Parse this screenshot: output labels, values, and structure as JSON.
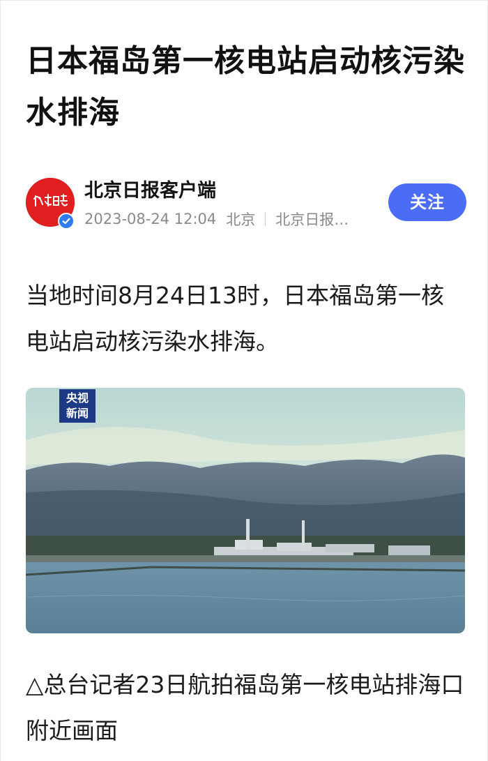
{
  "article": {
    "headline": "日本福岛第一核电站启动核污染水排海",
    "body": "当地时间8月24日13时，日本福岛第一核电站启动核污染水排海。",
    "caption": "△总台记者23日航拍福岛第一核电站排海口附近画面"
  },
  "author": {
    "name": "北京日报客户端",
    "avatar_logo_text": "北京日报",
    "date": "2023-08-24 12:04",
    "location": "北京",
    "source": "北京日报…",
    "follow_label": "关注",
    "verified_icon": "check-badge-icon"
  },
  "photo": {
    "watermark_line1": "央视",
    "watermark_line2": "新闻"
  },
  "colors": {
    "follow_button": "#4a6cf7",
    "avatar_bg": "#e02020",
    "verified_badge": "#2f7bf1",
    "watermark_bg": "#1c3a86"
  }
}
